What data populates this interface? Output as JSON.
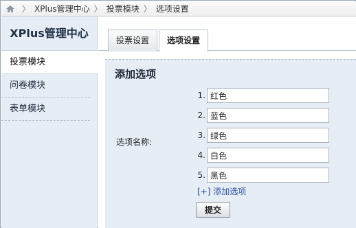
{
  "breadcrumb": {
    "items": [
      "XPlus管理中心",
      "投票模块",
      "选项设置"
    ],
    "separator": "〉"
  },
  "sidebar": {
    "title": "XPlus管理中心",
    "items": [
      {
        "label": "投票模块",
        "active": true
      },
      {
        "label": "问卷模块",
        "active": false
      },
      {
        "label": "表单模块",
        "active": false
      }
    ]
  },
  "tabs": [
    {
      "label": "投票设置",
      "active": false
    },
    {
      "label": "选项设置",
      "active": true
    }
  ],
  "form": {
    "title": "添加选项",
    "field_label": "选项名称:",
    "options": [
      {
        "num": "1.",
        "value": "红色"
      },
      {
        "num": "2.",
        "value": "蓝色"
      },
      {
        "num": "3.",
        "value": "绿色"
      },
      {
        "num": "4.",
        "value": "白色"
      },
      {
        "num": "5.",
        "value": "黑色"
      }
    ],
    "add_option_label": "[+] 添加选项",
    "submit_label": "提交"
  },
  "colors": {
    "sidebar_bg": "#e6edf5",
    "panel_bg": "#e6edf5",
    "link": "#2a4fa0",
    "border": "#9aa7b4"
  },
  "icons": {
    "home": "home-icon"
  }
}
